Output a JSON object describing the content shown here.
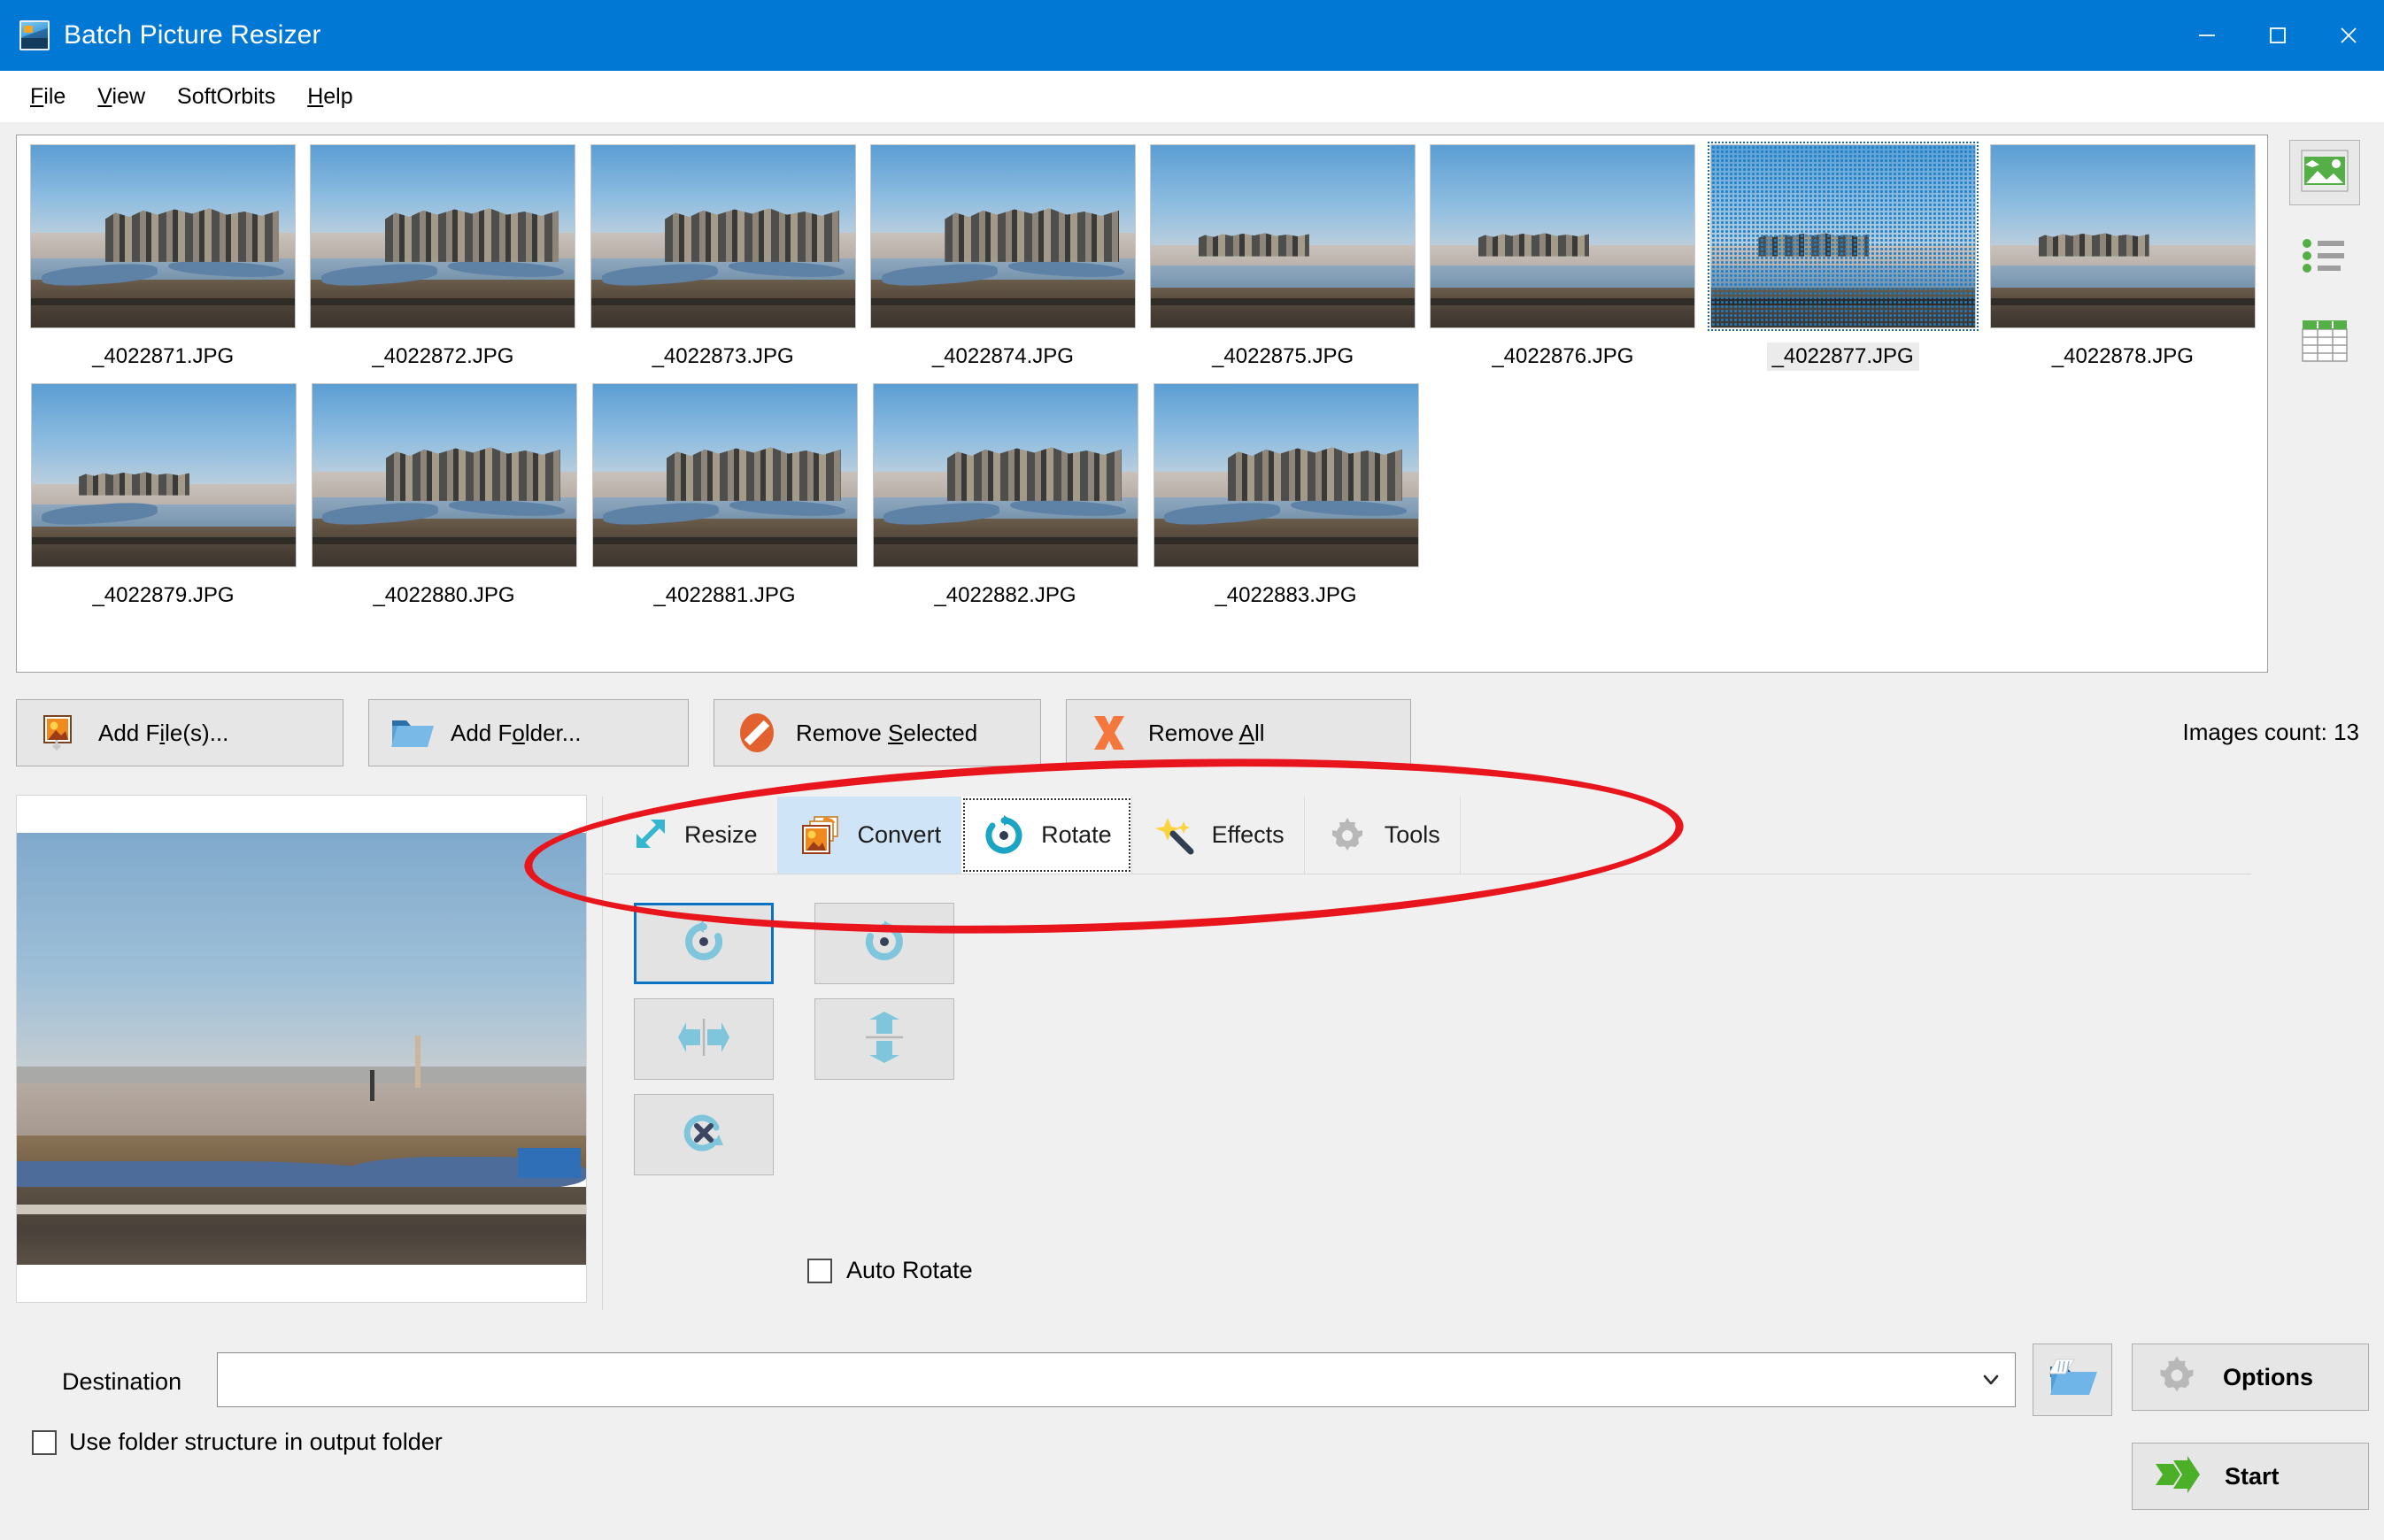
{
  "window": {
    "title": "Batch Picture Resizer",
    "icon": "app-picture-icon",
    "accent_blue": "#0178d4",
    "controls": {
      "minimize": "minimize",
      "maximize": "maximize",
      "close": "close"
    }
  },
  "menu": {
    "items": [
      {
        "label": "File",
        "pre": "",
        "accel": "F",
        "post": "ile"
      },
      {
        "label": "View",
        "pre": "",
        "accel": "V",
        "post": "iew"
      },
      {
        "label": "SoftOrbits",
        "pre": "SoftOrbits",
        "accel": "",
        "post": ""
      },
      {
        "label": "Help",
        "pre": "",
        "accel": "H",
        "post": "elp"
      }
    ]
  },
  "thumbnails": {
    "row1": [
      {
        "name": "_4022871.JPG",
        "variant": "near",
        "selected": false
      },
      {
        "name": "_4022872.JPG",
        "variant": "near",
        "selected": false
      },
      {
        "name": "_4022873.JPG",
        "variant": "near",
        "selected": false
      },
      {
        "name": "_4022874.JPG",
        "variant": "near",
        "selected": false
      },
      {
        "name": "_4022875.JPG",
        "variant": "far",
        "selected": false
      },
      {
        "name": "_4022876.JPG",
        "variant": "far",
        "selected": false
      },
      {
        "name": "_4022877.JPG",
        "variant": "far",
        "selected": true
      },
      {
        "name": "_4022878.JPG",
        "variant": "far",
        "selected": false
      }
    ],
    "row2": [
      {
        "name": "_4022879.JPG",
        "variant": "far",
        "selected": false
      },
      {
        "name": "_4022880.JPG",
        "variant": "near",
        "selected": false
      },
      {
        "name": "_4022881.JPG",
        "variant": "near",
        "selected": false
      },
      {
        "name": "_4022882.JPG",
        "variant": "near",
        "selected": false
      },
      {
        "name": "_4022883.JPG",
        "variant": "near",
        "selected": false
      }
    ]
  },
  "view_modes": [
    {
      "name": "thumbnail-view",
      "icon": "image-icon",
      "active": true
    },
    {
      "name": "list-view",
      "icon": "list-icon",
      "active": false
    },
    {
      "name": "details-view",
      "icon": "grid-icon",
      "active": false
    }
  ],
  "actions": {
    "add_files": {
      "pre": "Add F",
      "accel": "i",
      "post": "le(s)...",
      "label": "Add File(s)...",
      "icon": "picture-add-icon"
    },
    "add_folder": {
      "pre": "Add F",
      "accel": "o",
      "post": "lder...",
      "label": "Add Folder...",
      "icon": "folder-open-icon"
    },
    "remove_selected": {
      "pre": "Remove ",
      "accel": "S",
      "post": "elected",
      "label": "Remove Selected",
      "icon": "no-entry-icon"
    },
    "remove_all": {
      "pre": "Remove ",
      "accel": "A",
      "post": "ll",
      "label": "Remove All",
      "icon": "red-x-icon"
    }
  },
  "status": {
    "images_count": "Images count: 13"
  },
  "tabs": [
    {
      "label": "Resize",
      "icon": "resize-arrows-icon",
      "state": "normal"
    },
    {
      "label": "Convert",
      "icon": "convert-images-icon",
      "state": "hover"
    },
    {
      "label": "Rotate",
      "icon": "rotate-icon",
      "state": "active"
    },
    {
      "label": "Effects",
      "icon": "magic-wand-icon",
      "state": "normal"
    },
    {
      "label": "Tools",
      "icon": "gear-icon",
      "state": "normal"
    }
  ],
  "rotate_panel": {
    "buttons": [
      {
        "name": "rotate-left-button",
        "icon": "rotate-ccw-icon",
        "selected": true
      },
      {
        "name": "rotate-right-button",
        "icon": "rotate-cw-icon",
        "selected": false
      },
      {
        "name": "flip-horizontal-button",
        "icon": "flip-h-icon",
        "selected": false
      },
      {
        "name": "flip-vertical-button",
        "icon": "flip-v-icon",
        "selected": false
      },
      {
        "name": "no-rotation-button",
        "icon": "rotate-none-icon",
        "selected": false
      }
    ],
    "auto_rotate": {
      "label": "Auto Rotate",
      "checked": false
    }
  },
  "destination": {
    "label": "Destination",
    "value": "",
    "placeholder": "",
    "dropdown_icon": "chevron-down-icon",
    "browse_icon": "browse-folder-icon"
  },
  "use_folder_structure": {
    "label": "Use folder structure in output folder",
    "checked": false
  },
  "footer_buttons": {
    "options": {
      "label": "Options",
      "icon": "gear-icon"
    },
    "start": {
      "label": "Start",
      "icon": "green-arrow-icon"
    }
  },
  "annotation": {
    "shape": "ellipse",
    "color": "#e8161c",
    "target": "tab-strip"
  }
}
